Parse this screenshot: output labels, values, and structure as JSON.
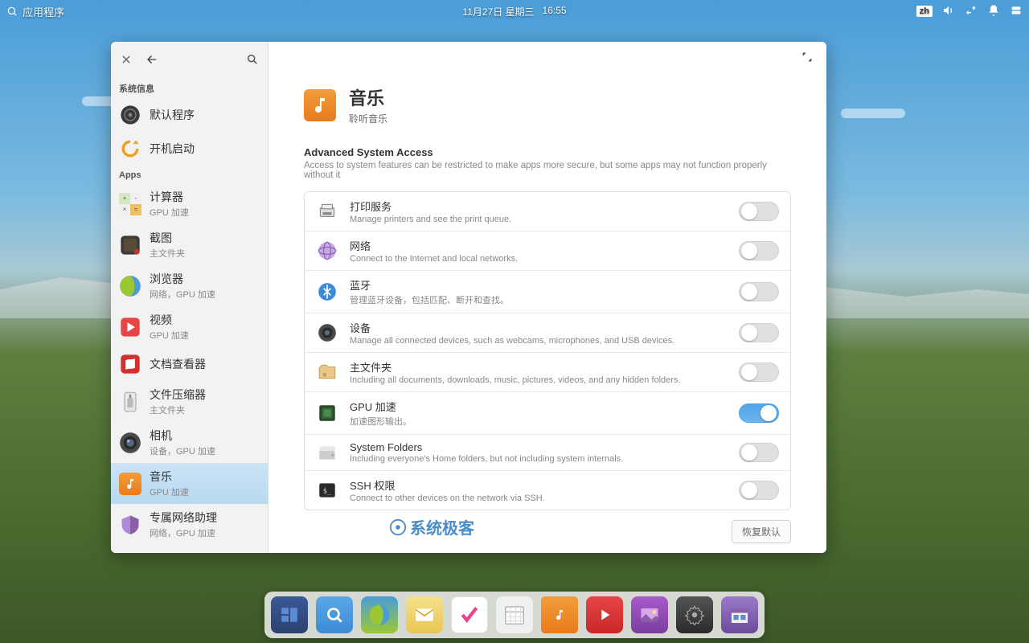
{
  "top_panel": {
    "app_menu": "应用程序",
    "date": "11月27日 星期三",
    "time": "16:55",
    "input_method": "zh"
  },
  "sidebar": {
    "section1": "系统信息",
    "section2": "Apps",
    "items1": [
      {
        "label": "默认程序"
      },
      {
        "label": "开机启动"
      }
    ],
    "items2": [
      {
        "label": "计算器",
        "sub": "GPU 加速"
      },
      {
        "label": "截图",
        "sub": "主文件夹"
      },
      {
        "label": "浏览器",
        "sub": "网络，GPU 加速"
      },
      {
        "label": "视频",
        "sub": "GPU 加速"
      },
      {
        "label": "文档查看器"
      },
      {
        "label": "文件压缩器",
        "sub": "主文件夹"
      },
      {
        "label": "相机",
        "sub": "设备，GPU 加速"
      },
      {
        "label": "音乐",
        "sub": "GPU 加速"
      },
      {
        "label": "专属网络助理",
        "sub": "网络，GPU 加速"
      }
    ]
  },
  "content": {
    "app_title": "音乐",
    "app_subtitle": "聆听音乐",
    "section_title": "Advanced System Access",
    "section_desc": "Access to system features can be restricted to make apps more secure, but some apps may not function properly without it",
    "perms": [
      {
        "title": "打印服务",
        "desc": "Manage printers and see the print queue.",
        "on": false
      },
      {
        "title": "网络",
        "desc": "Connect to the Internet and local networks.",
        "on": false
      },
      {
        "title": "蓝牙",
        "desc": "管理蓝牙设备，包括匹配、断开和查找。",
        "on": false
      },
      {
        "title": "设备",
        "desc": "Manage all connected devices, such as webcams, microphones, and USB devices.",
        "on": false
      },
      {
        "title": "主文件夹",
        "desc": "Including all documents, downloads, music, pictures, videos, and any hidden folders.",
        "on": false
      },
      {
        "title": "GPU 加速",
        "desc": "加速图形输出。",
        "on": true
      },
      {
        "title": "System Folders",
        "desc": "Including everyone's Home folders, but not including system internals.",
        "on": false
      },
      {
        "title": "SSH 权限",
        "desc": "Connect to other devices on the network via SSH.",
        "on": false
      }
    ],
    "restore_defaults": "恢复默认"
  },
  "watermark": "系统极客"
}
